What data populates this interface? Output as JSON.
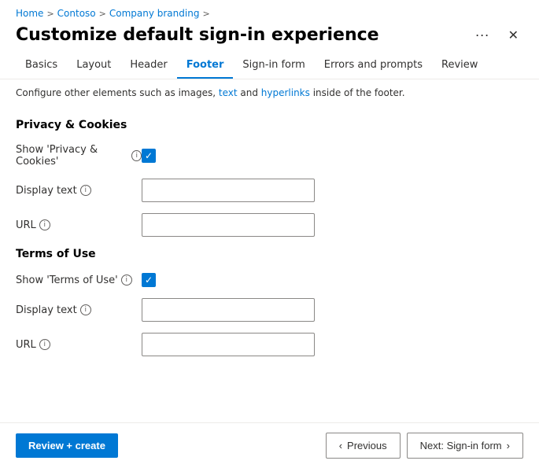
{
  "breadcrumb": {
    "items": [
      {
        "label": "Home",
        "link": true
      },
      {
        "label": "Contoso",
        "link": true
      },
      {
        "label": "Company branding",
        "link": true
      }
    ],
    "separators": [
      ">",
      ">",
      ">"
    ]
  },
  "header": {
    "title": "Customize default sign-in experience",
    "ellipsis_label": "···",
    "close_label": "✕"
  },
  "tabs": [
    {
      "id": "basics",
      "label": "Basics",
      "active": false
    },
    {
      "id": "layout",
      "label": "Layout",
      "active": false
    },
    {
      "id": "header",
      "label": "Header",
      "active": false
    },
    {
      "id": "footer",
      "label": "Footer",
      "active": true
    },
    {
      "id": "signin-form",
      "label": "Sign-in form",
      "active": false
    },
    {
      "id": "errors-prompts",
      "label": "Errors and prompts",
      "active": false
    },
    {
      "id": "review",
      "label": "Review",
      "active": false
    }
  ],
  "info_bar": {
    "text_before": "Configure other elements such as images, ",
    "link1": "text",
    "text_middle": " and ",
    "link2": "hyperlinks",
    "text_after": " inside of the footer."
  },
  "privacy_cookies": {
    "section_title": "Privacy & Cookies",
    "show_label": "Show 'Privacy & Cookies'",
    "show_checked": true,
    "display_text_label": "Display text",
    "display_text_value": "",
    "display_text_placeholder": "",
    "url_label": "URL",
    "url_value": "",
    "url_placeholder": ""
  },
  "terms_of_use": {
    "section_title": "Terms of Use",
    "show_label": "Show 'Terms of Use'",
    "show_checked": true,
    "display_text_label": "Display text",
    "display_text_value": "",
    "display_text_placeholder": "",
    "url_label": "URL",
    "url_value": "",
    "url_placeholder": ""
  },
  "footer": {
    "review_create_label": "Review + create",
    "previous_label": "Previous",
    "next_label": "Next: Sign-in form",
    "previous_arrow": "‹",
    "next_arrow": "›"
  },
  "icons": {
    "info": "i",
    "chevron_right": ">",
    "chevron_left": "‹",
    "chevron_next": "›"
  }
}
